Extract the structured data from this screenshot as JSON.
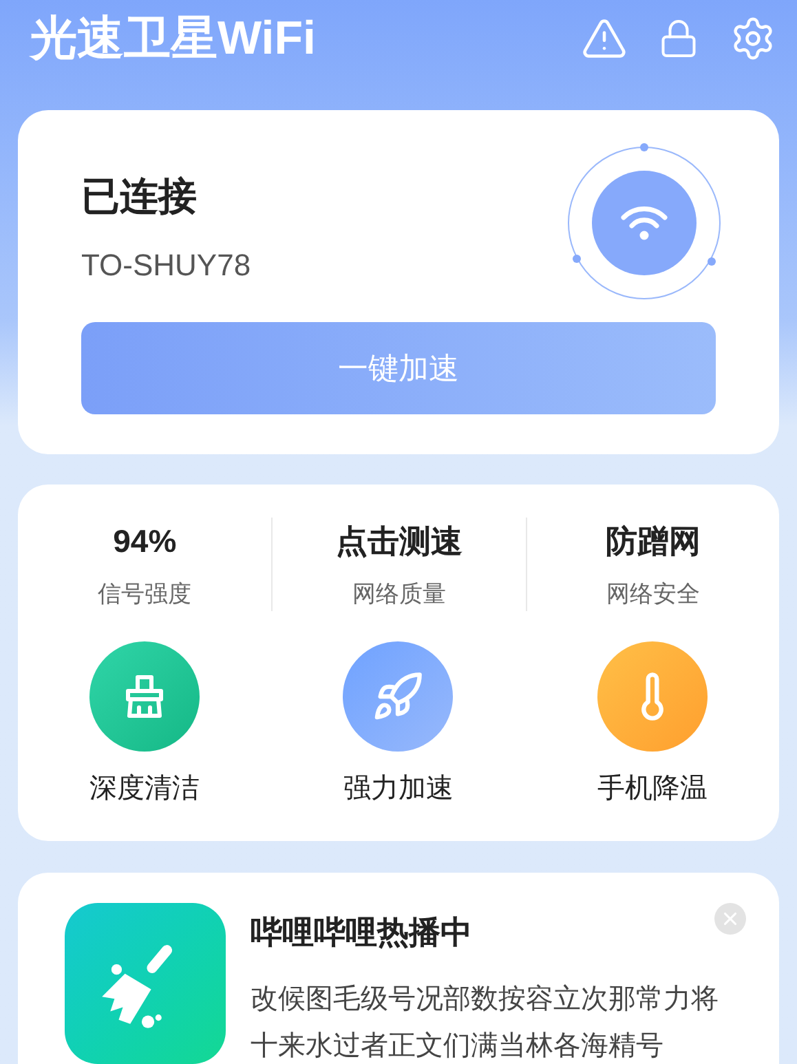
{
  "app_title": "光速卫星WiFi",
  "connection": {
    "status": "已连接",
    "network": "TO-SHUY78",
    "boost_button": "一键加速"
  },
  "stats": [
    {
      "value": "94%",
      "label": "信号强度"
    },
    {
      "value": "点击测速",
      "label": "网络质量"
    },
    {
      "value": "防蹭网",
      "label": "网络安全"
    }
  ],
  "tools": [
    {
      "kind": "clean",
      "label": "深度清洁"
    },
    {
      "kind": "boost",
      "label": "强力加速"
    },
    {
      "kind": "cool",
      "label": "手机降温"
    }
  ],
  "ad": {
    "title": "哔哩哔哩热播中",
    "body": "改候图毛级号况部数按容立次那常力将十来水过者正文们满当林各海精号"
  }
}
